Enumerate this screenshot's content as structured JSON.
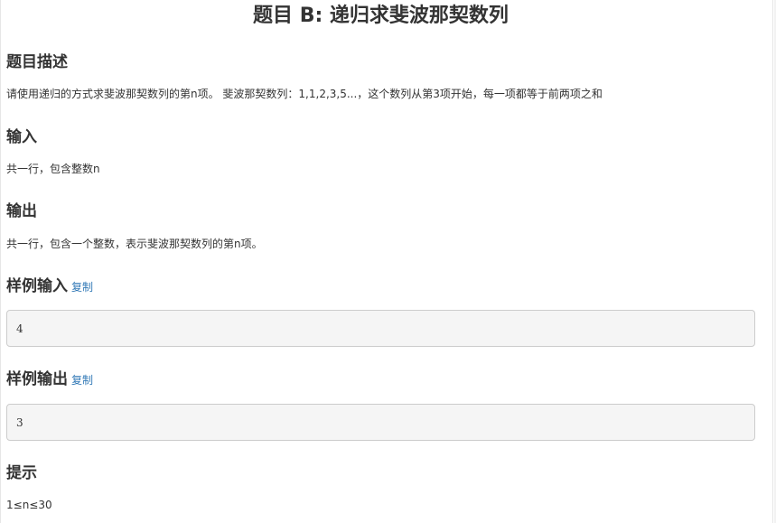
{
  "problem": {
    "title": "题目 B: 递归求斐波那契数列"
  },
  "sections": {
    "description": {
      "heading": "题目描述",
      "text": "请使用递归的方式求斐波那契数列的第n项。 斐波那契数列：1,1,2,3,5...，这个数列从第3项开始，每一项都等于前两项之和"
    },
    "input": {
      "heading": "输入",
      "text": "共一行，包含整数n"
    },
    "output": {
      "heading": "输出",
      "text": "共一行，包含一个整数，表示斐波那契数列的第n项。"
    },
    "sample_input": {
      "heading": "样例输入",
      "copy_label": "复制",
      "value": "4"
    },
    "sample_output": {
      "heading": "样例输出",
      "copy_label": "复制",
      "value": "3"
    },
    "hint": {
      "heading": "提示",
      "text": "1≤n≤30"
    }
  }
}
